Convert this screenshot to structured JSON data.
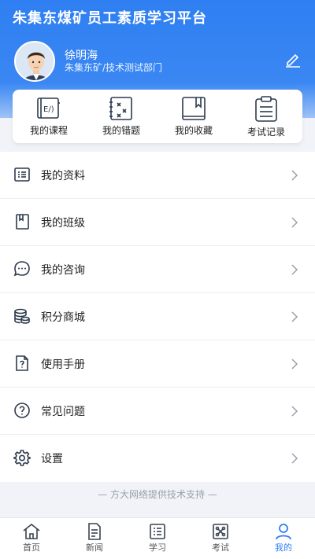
{
  "header": {
    "app_title": "朱集东煤矿员工素质学习平台",
    "user_name": "徐明海",
    "user_dept": "朱集东矿/技术测试部门",
    "edit_icon": "pencil-icon",
    "color": "#2f7ff2"
  },
  "quick_links": [
    {
      "label": "我的课程",
      "icon": "book-icon"
    },
    {
      "label": "我的错题",
      "icon": "wrong-questions-icon"
    },
    {
      "label": "我的收藏",
      "icon": "bookmark-icon"
    },
    {
      "label": "考试记录",
      "icon": "clipboard-icon"
    }
  ],
  "menu": [
    {
      "label": "我的资料",
      "icon": "profile-list-icon"
    },
    {
      "label": "我的班级",
      "icon": "class-icon"
    },
    {
      "label": "我的咨询",
      "icon": "chat-icon"
    },
    {
      "label": "积分商城",
      "icon": "coins-icon"
    },
    {
      "label": "使用手册",
      "icon": "manual-icon"
    },
    {
      "label": "常见问题",
      "icon": "question-icon"
    },
    {
      "label": "设置",
      "icon": "gear-icon"
    }
  ],
  "footer_note": "— 方大网络提供技术支持 —",
  "tabs": [
    {
      "label": "首页",
      "icon": "home-icon"
    },
    {
      "label": "新闻",
      "icon": "news-icon"
    },
    {
      "label": "学习",
      "icon": "study-icon"
    },
    {
      "label": "考试",
      "icon": "exam-icon"
    },
    {
      "label": "我的",
      "icon": "person-icon",
      "active": true
    }
  ]
}
